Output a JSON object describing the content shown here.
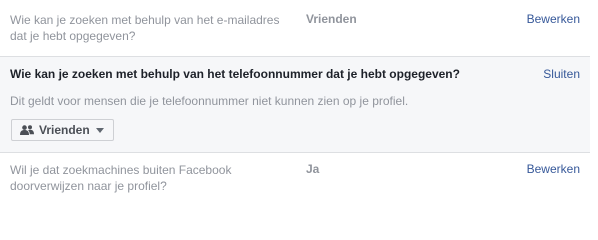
{
  "rows": [
    {
      "question": "Wie kan je zoeken met behulp van het e-mailadres dat je hebt opgegeven?",
      "value": "Vrienden",
      "action": "Bewerken"
    },
    {
      "question": "Wil je dat zoekmachines buiten Facebook doorverwijzen naar je profiel?",
      "value": "Ja",
      "action": "Bewerken"
    }
  ],
  "expanded": {
    "title": "Wie kan je zoeken met behulp van het telefoonnummer dat je hebt opgegeven?",
    "action": "Sluiten",
    "description": "Dit geldt voor mensen die je telefoonnummer niet kunnen zien op je profiel.",
    "audience": {
      "label": "Vrienden",
      "icon": "friends-icon",
      "dropdown_icon": "caret-down-icon"
    }
  }
}
